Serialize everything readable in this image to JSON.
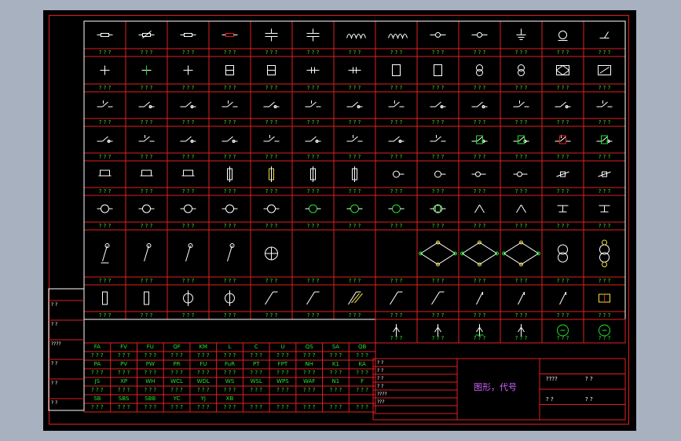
{
  "sheet": {
    "title_block": {
      "title": "图形，代号",
      "codes": [
        "????",
        "? ?",
        "? ?",
        "? ?"
      ]
    }
  },
  "symbol_labels": [
    [
      "? ? ?",
      "? ? ?",
      "? ? ?",
      "? ? ?",
      "? ? ?",
      "? ? ?",
      "? ? ?",
      "? ? ?",
      "? ? ?",
      "? ? ?",
      "? ? ?",
      "? ? ?",
      "? ? ?"
    ],
    [
      "? ? ?",
      "? ? ?",
      "? ? ?",
      "? ? ?",
      "? ? ?",
      "? ? ?",
      "? ? ?",
      "? ? ?",
      "? ? ?",
      "? ? ?",
      "? ? ?",
      "? ? ?",
      "? ? ?"
    ],
    [
      "? ? ?",
      "? ? ?",
      "? ? ?",
      "? ? ?",
      "? ? ?",
      "? ? ?",
      "? ? ?",
      "? ? ?",
      "? ? ?",
      "? ? ?",
      "? ? ?",
      "? ? ?",
      "? ? ?"
    ],
    [
      "? ? ?",
      "? ? ?",
      "? ? ?",
      "? ? ?",
      "? ? ?",
      "? ? ?",
      "? ? ?",
      "? ? ?",
      "? ? ?",
      "? ? ?",
      "? ? ?",
      "? ? ?",
      "? ? ?"
    ],
    [
      "? ? ?",
      "? ? ?",
      "? ? ?",
      "? ? ?",
      "? ? ?",
      "? ? ?",
      "? ? ?",
      "? ? ?",
      "? ? ?",
      "? ? ?",
      "? ? ?",
      "? ? ?",
      "? ? ?"
    ],
    [
      "? ? ?",
      "? ? ?",
      "? ? ?",
      "? ? ?",
      "? ? ?",
      "? ? ?",
      "? ? ?",
      "? ? ?",
      "? ? ?",
      "? ? ?",
      "? ? ?",
      "? ? ?",
      "? ? ?"
    ],
    [
      "? ? ?",
      "? ? ?",
      "? ? ?",
      "? ? ?",
      "? ? ?",
      "? ? ?",
      "? ? ?",
      "? ? ?",
      "? ? ?",
      "? ? ?",
      "? ? ?",
      "? ? ?",
      "? ? ?"
    ],
    [
      "? ? ?",
      "? ? ?",
      "? ? ?",
      "? ? ?",
      "? ? ?",
      "? ? ?",
      "? ? ?",
      "? ? ?",
      "? ? ?",
      "? ? ?",
      "? ? ?",
      "? ? ?",
      "? ? ?"
    ]
  ],
  "row9_labels": [
    "? ? ?",
    "? ? ?",
    "? ? ?",
    "? ? ?",
    "? ? ?",
    "? ? ?"
  ],
  "code_table": {
    "rows": [
      [
        "FA",
        "FV",
        "FU",
        "QF",
        "KM",
        "L",
        "C",
        "U",
        "QS",
        "SA",
        "QB"
      ],
      [
        "PA",
        "PV",
        "PW",
        "PR",
        "FU",
        "FuR",
        "PT",
        "FPT",
        "NH",
        "K1",
        "KA"
      ],
      [
        "JS",
        "XP",
        "WH",
        "WCL",
        "WDL",
        "WS",
        "WSL",
        "WPS",
        "WAF",
        "N1",
        "F"
      ],
      [
        "SB",
        "SBS",
        "SBB",
        "YC",
        "YJ",
        "XB",
        "",
        "",
        "",
        "",
        ""
      ]
    ],
    "row_labels": [
      "? ? ?",
      "? ? ?",
      "? ? ?",
      "? ? ?",
      "? ? ?",
      "? ? ?",
      "? ? ?",
      "? ? ?"
    ]
  },
  "left_strip": [
    "? ?",
    "? ?",
    "????",
    "? ?",
    "? ?",
    "? ?"
  ],
  "title_block_rows": [
    "? ?",
    "? ?",
    "? ?",
    "? ?",
    "????",
    "???"
  ]
}
